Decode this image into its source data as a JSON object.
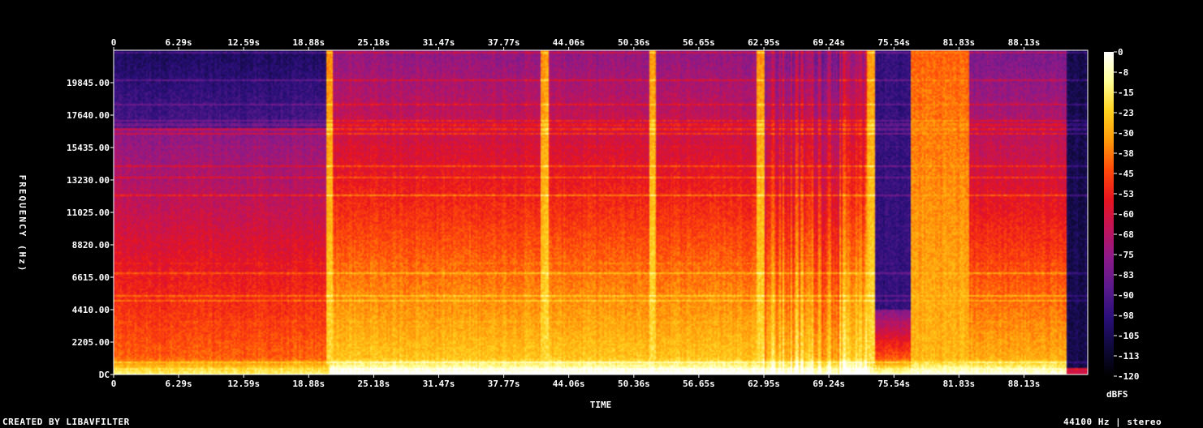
{
  "chart_data": {
    "type": "heatmap",
    "xlabel": "TIME",
    "ylabel": "FREQUENCY (Hz)",
    "x_ticks": [
      "0",
      "6.29s",
      "12.59s",
      "18.88s",
      "25.18s",
      "31.47s",
      "37.77s",
      "44.06s",
      "50.36s",
      "56.65s",
      "62.95s",
      "69.24s",
      "75.54s",
      "81.83s",
      "88.13s"
    ],
    "x_tick_values": [
      0,
      6.29,
      12.59,
      18.88,
      25.18,
      31.47,
      37.77,
      44.06,
      50.36,
      56.65,
      62.95,
      69.24,
      75.54,
      81.83,
      88.13
    ],
    "xlim": [
      0,
      94.3
    ],
    "y_ticks": [
      "DC",
      "2205.00",
      "4410.00",
      "6615.00",
      "8820.00",
      "11025.00",
      "13230.00",
      "15435.00",
      "17640.00",
      "19845.00"
    ],
    "y_tick_values": [
      0,
      2205,
      4410,
      6615,
      8820,
      11025,
      13230,
      15435,
      17640,
      19845
    ],
    "ylim": [
      0,
      22050
    ],
    "colorbar": {
      "label": "dBFS",
      "ticks": [
        "0",
        "-8",
        "-15",
        "-23",
        "-30",
        "-38",
        "-45",
        "-53",
        "-60",
        "-68",
        "-75",
        "-83",
        "-90",
        "-98",
        "-105",
        "-113",
        "-120"
      ],
      "range": [
        -120,
        0
      ]
    },
    "colormap": [
      "#000000",
      "#0f0a3c",
      "#2a0f7a",
      "#5a1a8c",
      "#8c1a8a",
      "#c0145a",
      "#e8141e",
      "#ff4a0a",
      "#ff9a0a",
      "#ffd21e",
      "#ffff96",
      "#ffffff"
    ],
    "transients_s": [
      20.9,
      41.7,
      52.2,
      62.6,
      73.3
    ],
    "dark_gap_s": [
      73.6,
      76.9
    ],
    "loud_block_s": [
      77.1,
      82.8
    ],
    "silence_after_s": 92.2
  },
  "footer": {
    "left": "CREATED BY LIBAVFILTER",
    "right": "44100 Hz | stereo"
  }
}
